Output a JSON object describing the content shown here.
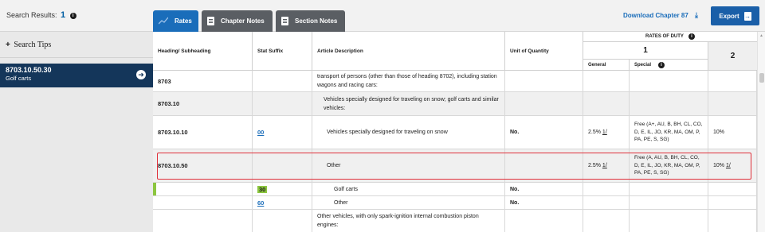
{
  "header": {
    "search_results_label": "Search Results:",
    "search_results_count": "1",
    "tabs": [
      {
        "label": "Rates",
        "active": true
      },
      {
        "label": "Chapter Notes",
        "active": false
      },
      {
        "label": "Section Notes",
        "active": false
      }
    ],
    "download_label": "Download Chapter 87",
    "export_label": "Export"
  },
  "sidebar": {
    "search_tips_label": "Search Tips",
    "selected": {
      "code": "8703.10.50.30",
      "description": "Golf carts"
    }
  },
  "table": {
    "columns": {
      "heading": "Heading/ Subheading",
      "stat_suffix": "Stat Suffix",
      "article": "Article Description",
      "unit": "Unit of Quantity",
      "rates_of_duty": "RATES OF DUTY",
      "col1": "1",
      "col2": "2",
      "general": "General",
      "special": "Special"
    },
    "rows": [
      {
        "heading": "8703",
        "stat": "",
        "description": "transport of persons (other than those of heading 8702), including station wagons and racing cars:",
        "unit": "",
        "general": "",
        "special": "",
        "col2": ""
      },
      {
        "heading": "8703.10",
        "stat": "",
        "description": "Vehicles specially designed for traveling on snow; golf carts and similar vehicles:",
        "unit": "",
        "general": "",
        "special": "",
        "col2": ""
      },
      {
        "heading": "8703.10.10",
        "stat": "00",
        "description": "Vehicles specially designed for traveling on snow",
        "unit": "No.",
        "general": "2.5%",
        "general_note": "1/",
        "special": "Free (A+, AU, B, BH, CL, CO, D, E, IL, JO, KR, MA, OM, P, PA, PE, S, SG)",
        "col2": "10%"
      },
      {
        "heading": "8703.10.50",
        "stat": "",
        "description": "Other",
        "unit": "",
        "general": "2.5%",
        "general_note": "1/",
        "special": "Free (A, AU, B, BH, CL, CO, D, E, IL, JO, KR, MA, OM, P, PA, PE, S, SG)",
        "col2": "10%",
        "col2_note": "1/"
      },
      {
        "heading": "",
        "stat": "30",
        "description": "Golf carts",
        "unit": "No.",
        "general": "",
        "special": "",
        "col2": ""
      },
      {
        "heading": "",
        "stat": "60",
        "description": "Other",
        "unit": "No.",
        "general": "",
        "special": "",
        "col2": ""
      },
      {
        "heading": "",
        "stat": "",
        "description": "Other vehicles, with only spark-ignition internal combustion piston engines:",
        "unit": "",
        "general": "",
        "special": "",
        "col2": ""
      }
    ]
  },
  "colors": {
    "accent_blue": "#1a6dba",
    "selected_navy": "#14365a",
    "highlight_red": "#e0303a",
    "stat_green": "#8cc63f"
  }
}
